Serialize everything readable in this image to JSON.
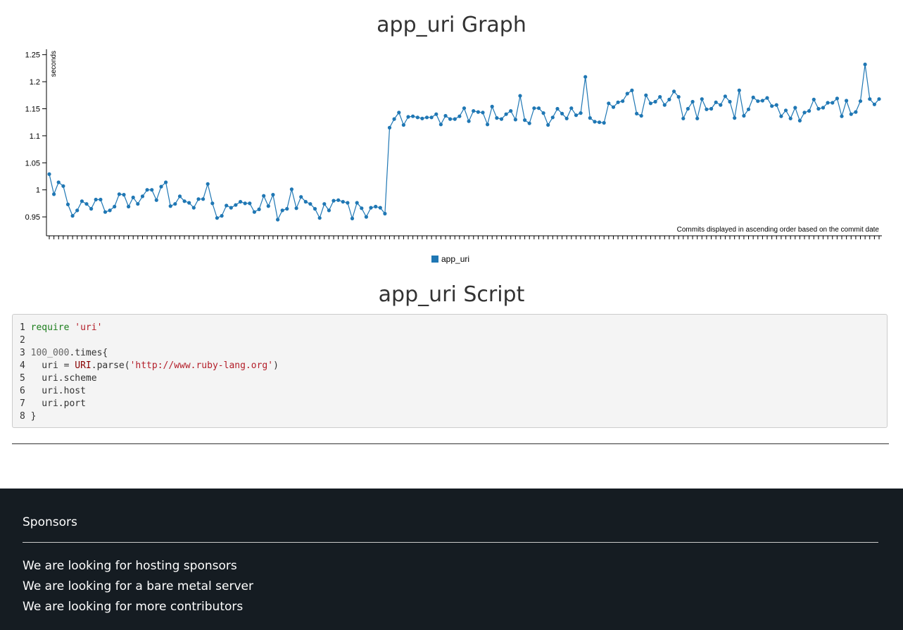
{
  "page": {
    "graph_title": "app_uri Graph",
    "script_title": "app_uri Script"
  },
  "chart_data": {
    "type": "line",
    "ylabel": "seconds",
    "xlabel": "Commits displayed in ascending order based on the commit date",
    "ylim": [
      0.915,
      1.26
    ],
    "yticks": [
      0.95,
      1,
      1.05,
      1.1,
      1.15,
      1.2,
      1.25
    ],
    "yticklabels": [
      "0.95",
      "1",
      "1.05",
      "1.1",
      "1.15",
      "1.2",
      "1.25"
    ],
    "grid": false,
    "legend": "bottom-center",
    "color": "#1f77b4",
    "series": [
      {
        "name": "app_uri",
        "values": [
          1.029,
          0.992,
          1.014,
          1.007,
          0.973,
          0.952,
          0.962,
          0.979,
          0.974,
          0.965,
          0.982,
          0.982,
          0.959,
          0.962,
          0.969,
          0.992,
          0.991,
          0.969,
          0.986,
          0.974,
          0.988,
          1.0,
          1.0,
          0.981,
          1.006,
          1.014,
          0.97,
          0.974,
          0.988,
          0.979,
          0.976,
          0.967,
          0.983,
          0.983,
          1.011,
          0.975,
          0.948,
          0.952,
          0.971,
          0.967,
          0.972,
          0.978,
          0.975,
          0.975,
          0.959,
          0.964,
          0.989,
          0.97,
          0.991,
          0.945,
          0.962,
          0.965,
          1.001,
          0.966,
          0.987,
          0.978,
          0.974,
          0.965,
          0.948,
          0.974,
          0.962,
          0.98,
          0.981,
          0.978,
          0.976,
          0.947,
          0.976,
          0.966,
          0.95,
          0.967,
          0.969,
          0.967,
          0.956,
          1.115,
          1.131,
          1.143,
          1.12,
          1.135,
          1.136,
          1.134,
          1.132,
          1.134,
          1.134,
          1.14,
          1.121,
          1.137,
          1.131,
          1.131,
          1.136,
          1.151,
          1.127,
          1.146,
          1.144,
          1.143,
          1.121,
          1.154,
          1.133,
          1.131,
          1.14,
          1.146,
          1.13,
          1.174,
          1.129,
          1.123,
          1.151,
          1.151,
          1.142,
          1.12,
          1.134,
          1.15,
          1.141,
          1.132,
          1.151,
          1.138,
          1.142,
          1.209,
          1.133,
          1.126,
          1.125,
          1.124,
          1.16,
          1.153,
          1.162,
          1.164,
          1.178,
          1.184,
          1.141,
          1.137,
          1.175,
          1.16,
          1.163,
          1.172,
          1.157,
          1.167,
          1.182,
          1.172,
          1.132,
          1.15,
          1.163,
          1.132,
          1.168,
          1.149,
          1.15,
          1.162,
          1.157,
          1.173,
          1.163,
          1.133,
          1.184,
          1.137,
          1.149,
          1.171,
          1.164,
          1.165,
          1.17,
          1.155,
          1.157,
          1.136,
          1.147,
          1.132,
          1.152,
          1.128,
          1.143,
          1.146,
          1.167,
          1.15,
          1.152,
          1.161,
          1.161,
          1.169,
          1.136,
          1.165,
          1.14,
          1.144,
          1.164,
          1.232,
          1.168,
          1.158,
          1.168
        ]
      }
    ]
  },
  "script": {
    "lines": [
      {
        "n": "1",
        "tokens": [
          {
            "t": "require",
            "c": "kw"
          },
          {
            "t": " ",
            "c": ""
          },
          {
            "t": "'uri'",
            "c": "str"
          }
        ]
      },
      {
        "n": "2",
        "tokens": []
      },
      {
        "n": "3",
        "tokens": [
          {
            "t": "100_000",
            "c": "num"
          },
          {
            "t": ".times{",
            "c": ""
          }
        ]
      },
      {
        "n": "4",
        "tokens": [
          {
            "t": "  uri = ",
            "c": ""
          },
          {
            "t": "URI",
            "c": "const"
          },
          {
            "t": ".parse(",
            "c": ""
          },
          {
            "t": "'http://www.ruby-lang.org'",
            "c": "str"
          },
          {
            "t": ")",
            "c": ""
          }
        ]
      },
      {
        "n": "5",
        "tokens": [
          {
            "t": "  uri.scheme",
            "c": ""
          }
        ]
      },
      {
        "n": "6",
        "tokens": [
          {
            "t": "  uri.host",
            "c": ""
          }
        ]
      },
      {
        "n": "7",
        "tokens": [
          {
            "t": "  uri.port",
            "c": ""
          }
        ]
      },
      {
        "n": "8",
        "tokens": [
          {
            "t": "}",
            "c": ""
          }
        ]
      }
    ]
  },
  "footer": {
    "heading": "Sponsors",
    "items": [
      "We are looking for hosting sponsors",
      "We are looking for a bare metal server",
      "We are looking for more contributors"
    ]
  }
}
